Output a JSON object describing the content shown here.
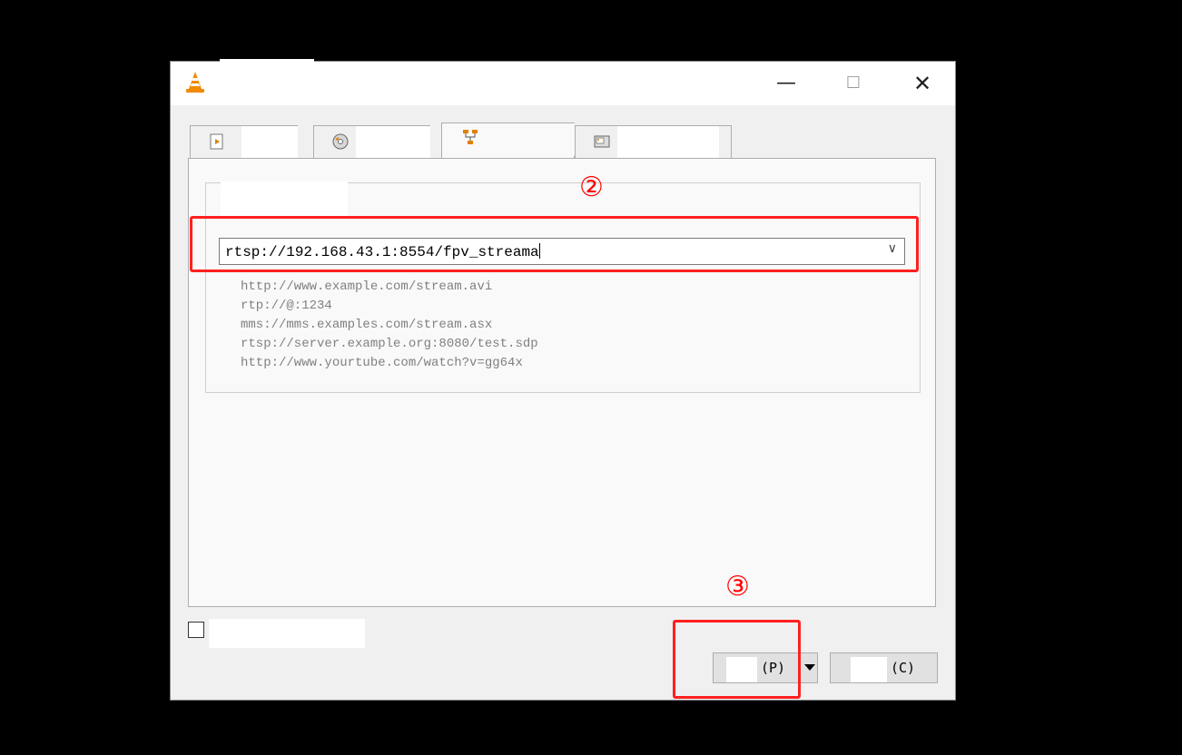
{
  "window": {
    "title": "",
    "controls": {
      "minimize": "—",
      "maximize": "☐",
      "close": "✕"
    }
  },
  "tabs": [
    {
      "icon": "file-play-icon",
      "label": ""
    },
    {
      "icon": "disc-icon",
      "label": ""
    },
    {
      "icon": "network-icon",
      "label": "",
      "active": true
    },
    {
      "icon": "capture-device-icon",
      "label": ""
    }
  ],
  "network": {
    "group_label": "",
    "url_value": "rtsp://192.168.43.1:8554/fpv_streama",
    "examples": [
      "http://www.example.com/stream.avi",
      "rtp://@:1234",
      "mms://mms.examples.com/stream.asx",
      "rtsp://server.example.org:8080/test.sdp",
      "http://www.yourtube.com/watch?v=gg64x"
    ]
  },
  "footer": {
    "show_more_options": {
      "checked": false,
      "label": ""
    },
    "play_button": {
      "prefix": "",
      "accelerator": "(P)"
    },
    "cancel_button": {
      "prefix": "",
      "accelerator": "(C)"
    }
  },
  "annotations": [
    {
      "label": "②"
    },
    {
      "label": "③"
    }
  ],
  "colors": {
    "annotation": "#ff0000",
    "window_bg": "#f0f0f0",
    "backdrop": "#000000"
  }
}
